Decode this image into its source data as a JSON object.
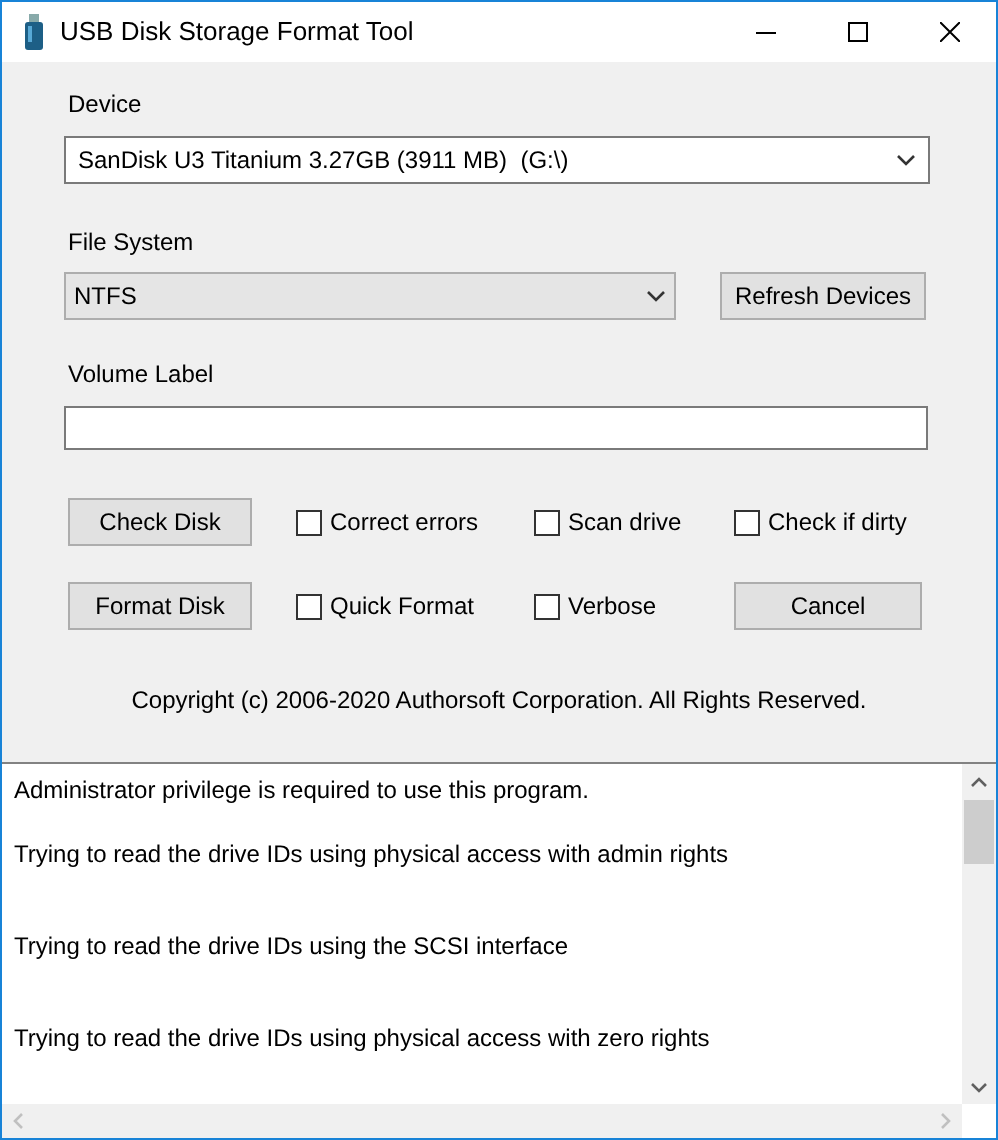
{
  "window": {
    "title": "USB Disk Storage Format Tool"
  },
  "device": {
    "label": "Device",
    "value": "SanDisk U3 Titanium 3.27GB (3911 MB)  (G:\\)"
  },
  "file_system": {
    "label": "File System",
    "value": "NTFS"
  },
  "refresh_button": "Refresh Devices",
  "volume_label": {
    "label": "Volume Label"
  },
  "rows": [
    {
      "button": "Check Disk",
      "options": [
        {
          "label": "Correct errors",
          "checked": false
        },
        {
          "label": "Scan drive",
          "checked": false
        },
        {
          "label": "Check if dirty",
          "checked": false
        }
      ]
    },
    {
      "button": "Format Disk",
      "options": [
        {
          "label": "Quick Format",
          "checked": false
        },
        {
          "label": "Verbose",
          "checked": false
        }
      ],
      "end_button": "Cancel"
    }
  ],
  "copyright": "Copyright (c) 2006-2020 Authorsoft Corporation. All Rights Reserved.",
  "log": [
    "Administrator privilege is required to use this program.",
    "Trying to read the drive IDs using physical access with admin rights",
    "Trying to read the drive IDs using the SCSI interface",
    "Trying to read the drive IDs using physical access with zero rights"
  ]
}
